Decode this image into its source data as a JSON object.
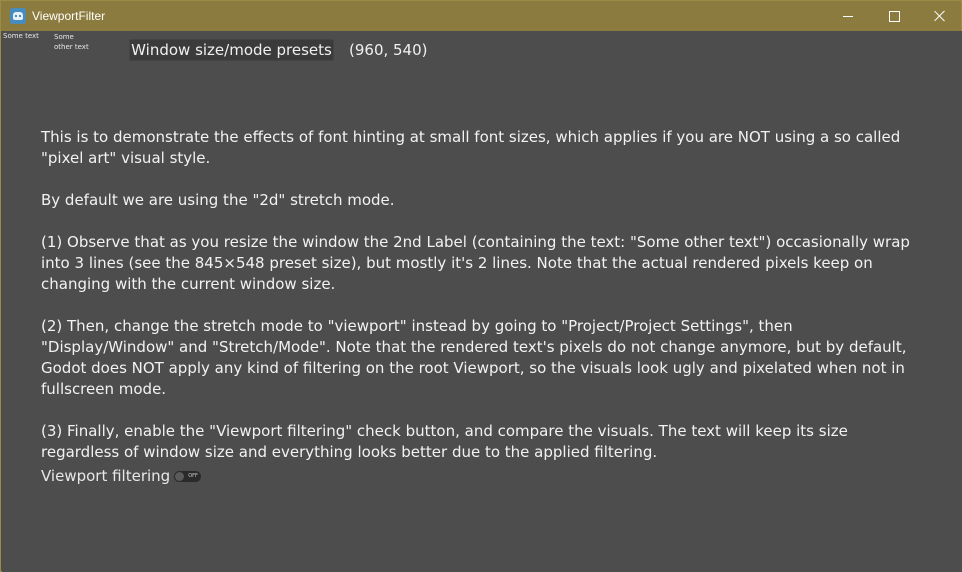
{
  "window": {
    "title": "ViewportFilter"
  },
  "labels": {
    "small_label_1": "Some text",
    "small_label_2": "Some other text"
  },
  "presets_button": "Window size/mode presets",
  "size_readout": "(960, 540)",
  "description": [
    "This is to demonstrate the effects of font hinting at small font sizes, which applies if you are NOT using a so called \"pixel art\" visual style.",
    "By default we are using the \"2d\" stretch mode.",
    "(1) Observe that as you resize the window the 2nd Label (containing the text: \"Some other text\") occasionally wrap into 3 lines (see the 845×548 preset size), but mostly it's 2 lines. Note that the actual rendered pixels keep on changing with the current window size.",
    "(2) Then, change the stretch mode to \"viewport\" instead by going to \"Project/Project Settings\", then \"Display/Window\" and \"Stretch/Mode\". Note that the rendered text's pixels do not change anymore, but by default, Godot does NOT apply any kind of filtering on the root Viewport, so the visuals look ugly and pixelated when not in fullscreen mode.",
    "(3) Finally, enable the \"Viewport filtering\" check button, and compare the visuals. The text will keep its size regardless of window size and everything looks better due to the applied filtering."
  ],
  "viewport_filtering": {
    "label": "Viewport filtering",
    "state_text": "OFF",
    "enabled": false
  },
  "colors": {
    "titlebar": "#8c7b3f",
    "background": "#4d4d4d",
    "text": "#f2f2f2"
  },
  "icons": {
    "app": "godot-icon",
    "minimize": "minimize-icon",
    "maximize": "maximize-icon",
    "close": "close-icon"
  }
}
